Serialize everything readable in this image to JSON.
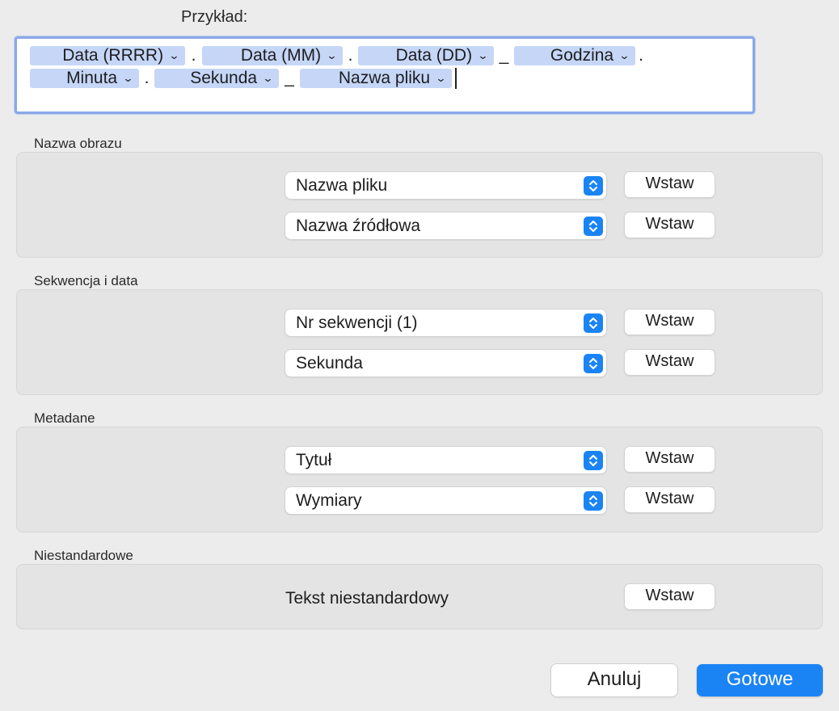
{
  "example": {
    "label": "Przykład:",
    "row1": [
      {
        "label": "Data (RRRR)"
      },
      {
        "sep": "."
      },
      {
        "label": "Data (MM)"
      },
      {
        "sep": "."
      },
      {
        "label": "Data (DD)"
      },
      {
        "sep": "_"
      },
      {
        "label": "Godzina"
      },
      {
        "sep": "."
      }
    ],
    "row2": [
      {
        "label": "Minuta"
      },
      {
        "sep": "."
      },
      {
        "label": "Sekunda"
      },
      {
        "sep": "_"
      },
      {
        "label": "Nazwa pliku"
      }
    ],
    "token_chevron": "⌄"
  },
  "sections": {
    "image_name": {
      "title": "Nazwa obrazu",
      "select1": "Nazwa pliku",
      "select2": "Nazwa źródłowa"
    },
    "sequence_date": {
      "title": "Sekwencja i data",
      "select1": "Nr sekwencji (1)",
      "select2": "Sekunda"
    },
    "metadata": {
      "title": "Metadane",
      "select1": "Tytuł",
      "select2": "Wymiary"
    },
    "custom": {
      "title": "Niestandardowe",
      "text": "Tekst niestandardowy"
    }
  },
  "insert_label": "Wstaw",
  "footer": {
    "cancel": "Anuluj",
    "done": "Gotowe"
  },
  "icons": {
    "popup_stepper": "chevron-up-down-icon"
  },
  "colors": {
    "accent": "#1a84f5",
    "token_bg": "#c5d6f7",
    "focus_ring": "#8aa9e6"
  }
}
